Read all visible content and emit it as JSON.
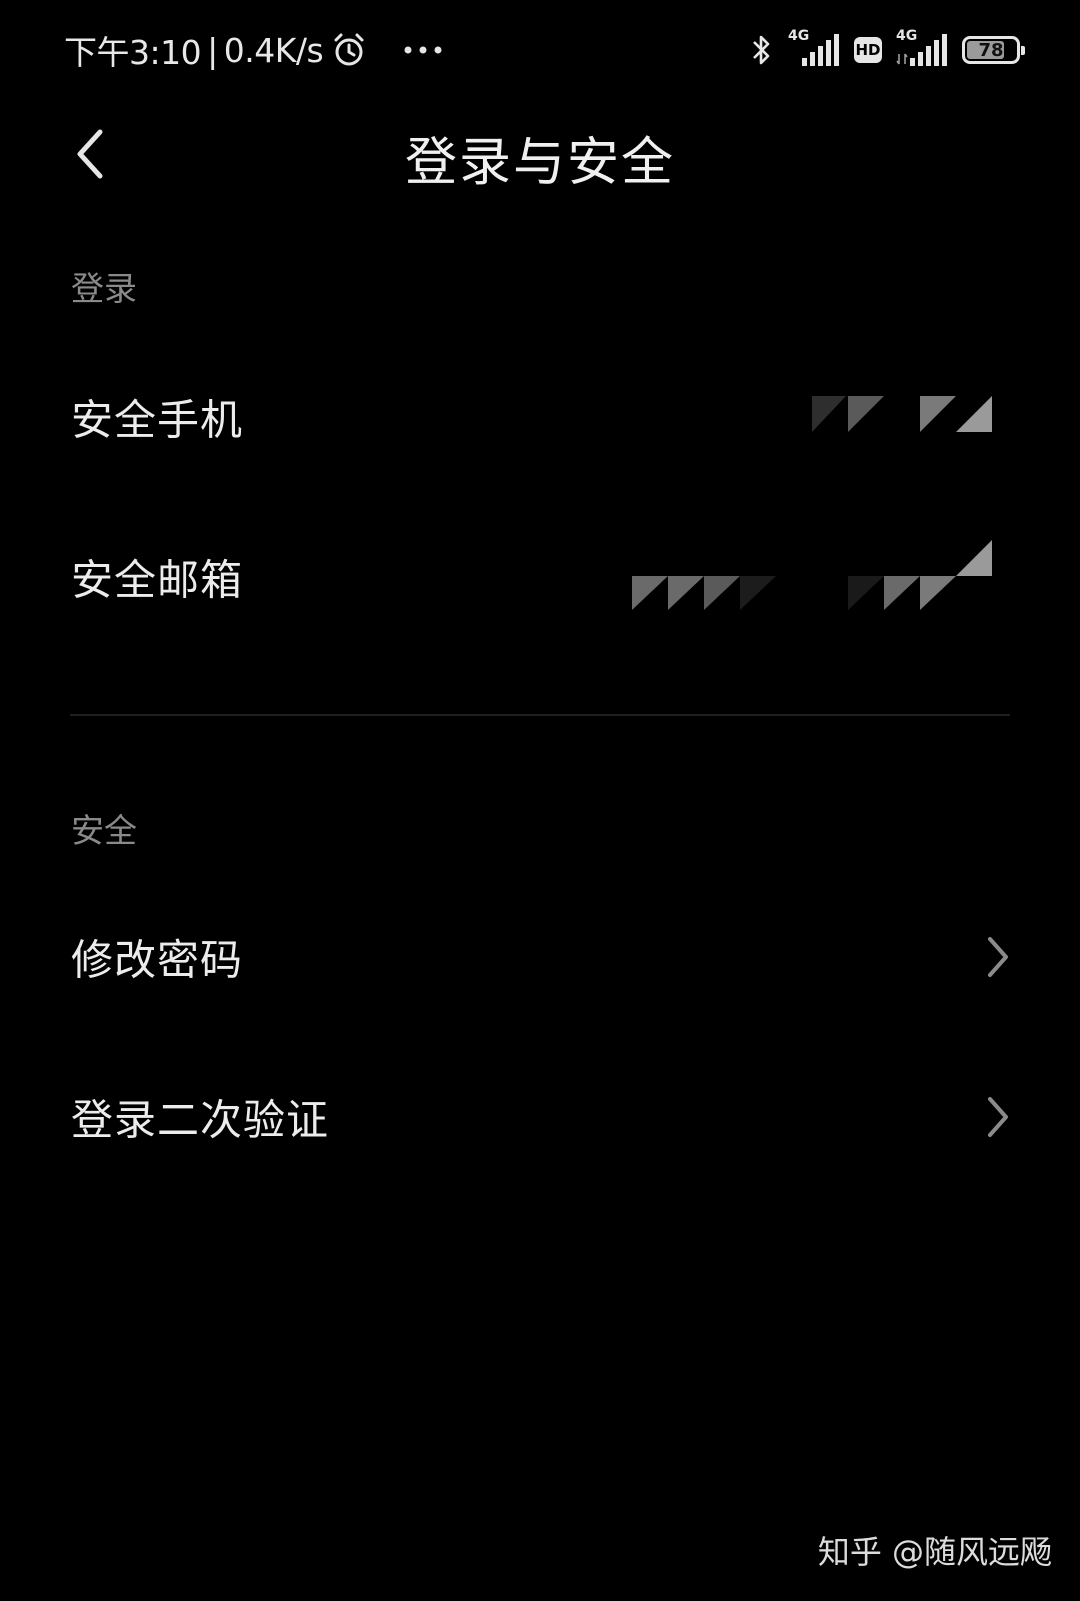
{
  "status_bar": {
    "time": "下午3:10",
    "separator": "|",
    "net_speed": "0.4K/s",
    "icons": [
      "alarm-icon",
      "more-dots-icon",
      "bluetooth-icon",
      "signal-4g-icon",
      "hd-icon",
      "signal-4g-icon",
      "battery-icon"
    ],
    "network_type_1": "4G",
    "hd_label": "HD",
    "network_type_2": "4G",
    "battery_level": "78",
    "battery_fraction": 0.78
  },
  "header": {
    "title": "登录与安全",
    "back_icon": "chevron-left-icon"
  },
  "sections": {
    "login": {
      "label": "登录",
      "items": [
        {
          "label": "安全手机",
          "value": ""
        },
        {
          "label": "安全邮箱",
          "value": ""
        }
      ]
    },
    "security": {
      "label": "安全",
      "items": [
        {
          "label": "修改密码",
          "icon": "chevron-right-icon"
        },
        {
          "label": "登录二次验证",
          "icon": "chevron-right-icon"
        }
      ]
    }
  },
  "watermark": "知乎 @随风远飏",
  "colors": {
    "background": "#000000",
    "primary_text": "#ececec",
    "secondary_text": "#8a8a8a",
    "divider": "#1f1f1f"
  }
}
